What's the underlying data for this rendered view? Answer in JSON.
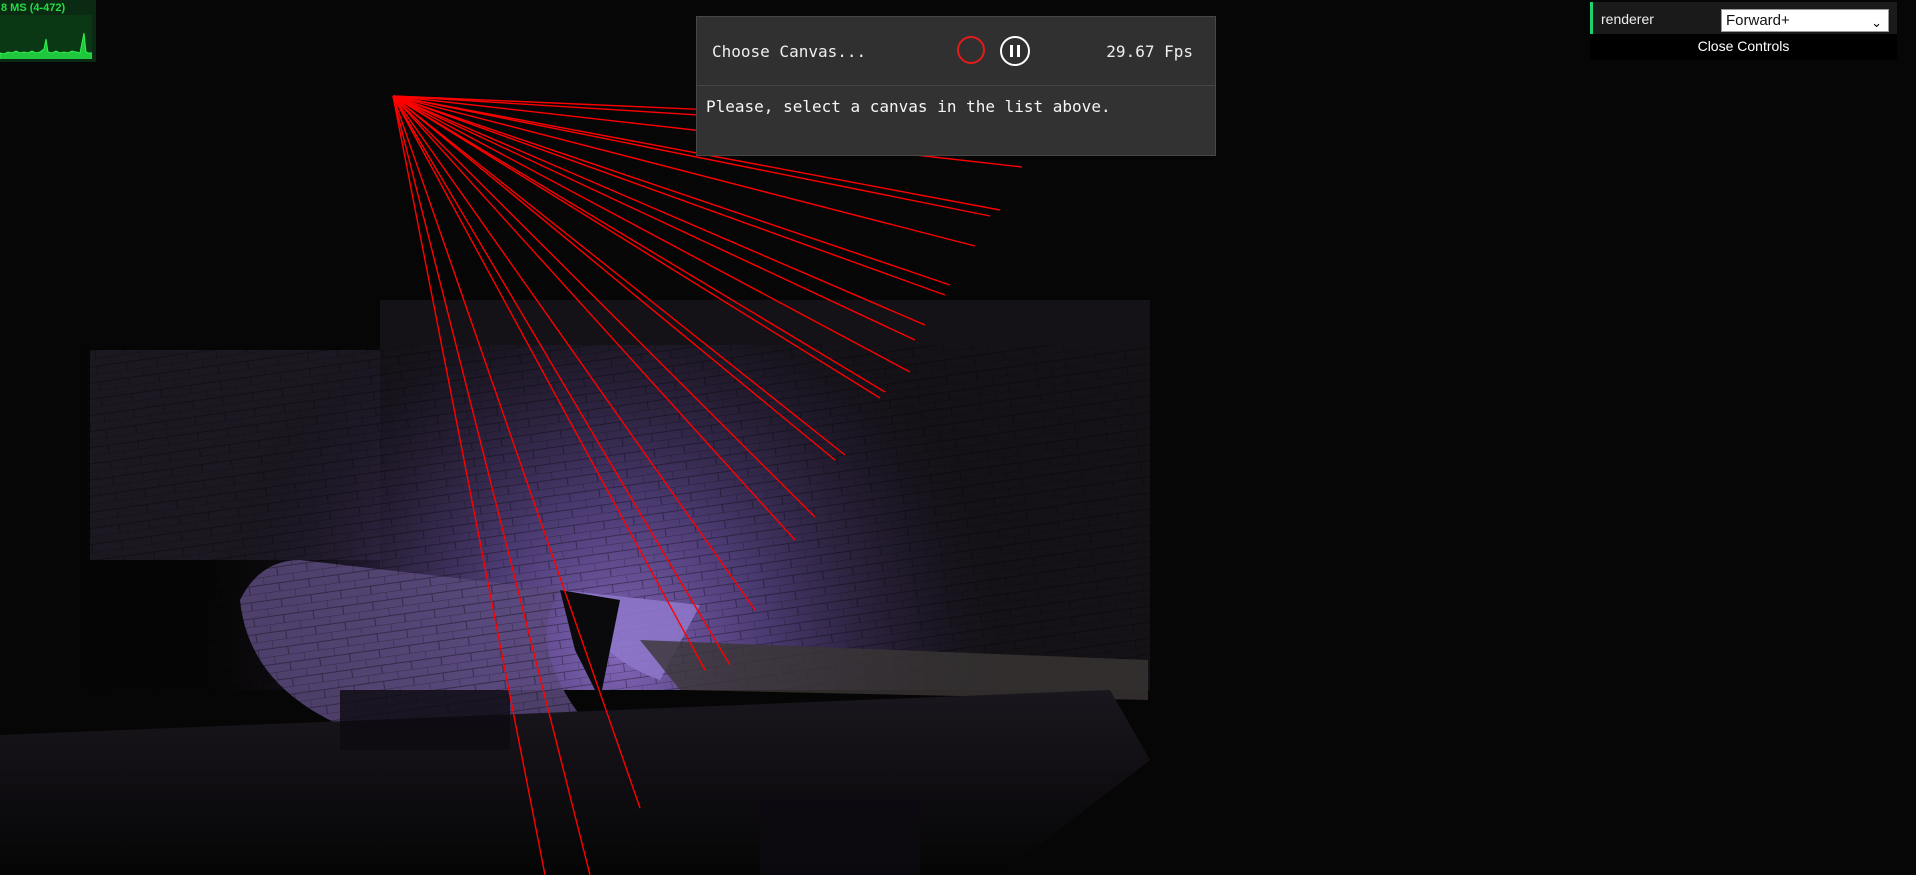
{
  "stats": {
    "readout": "8 MS (4-472)"
  },
  "spector": {
    "choose_canvas_label": "Choose Canvas...",
    "fps_text": "29.67 Fps",
    "message": "Please, select a canvas in the list above.",
    "record_icon": "record-icon",
    "pause_icon": "pause-icon"
  },
  "gui": {
    "renderer_label": "renderer",
    "renderer_value": "Forward+",
    "close_label": "Close Controls"
  },
  "colors": {
    "laser": "#ff0000",
    "stats_green": "#22dd44",
    "lit_wall": "#7a5fb0",
    "background": "#070606"
  }
}
